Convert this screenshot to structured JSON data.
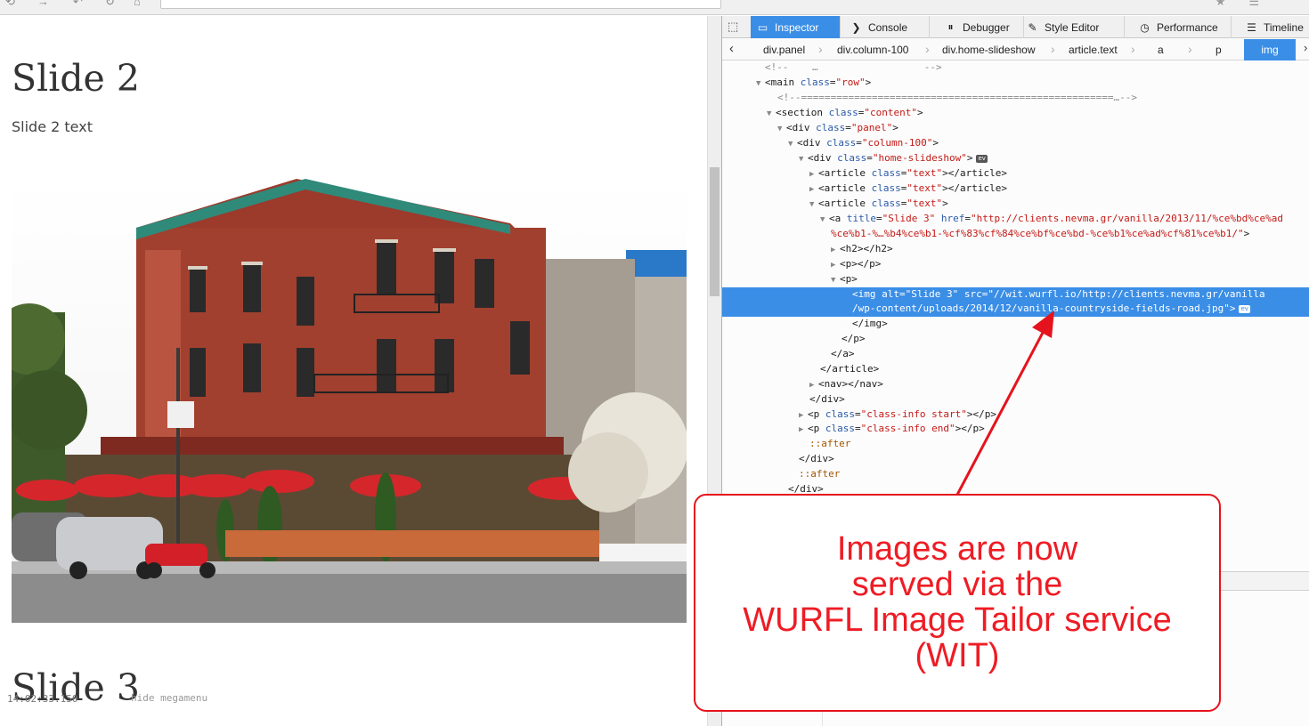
{
  "page": {
    "slide2_title": "Slide 2",
    "slide2_text": "Slide 2 text",
    "slide3_title": "Slide 3"
  },
  "devtools": {
    "tabs": [
      {
        "label": "Inspector",
        "icon": "inspector-icon"
      },
      {
        "label": "Console",
        "icon": "console-icon"
      },
      {
        "label": "Debugger",
        "icon": "debugger-icon"
      },
      {
        "label": "Style Editor",
        "icon": "style-editor-icon"
      },
      {
        "label": "Performance",
        "icon": "performance-icon"
      },
      {
        "label": "Timeline",
        "icon": "timeline-icon"
      }
    ],
    "breadcrumbs": [
      "div.panel",
      "div.column-100",
      "div.home-slideshow",
      "article.text",
      "a",
      "p",
      "img"
    ],
    "markup": {
      "comment_top": "<!--    …                  -->",
      "comment_bar": "<!--=====================================================…-->",
      "href_value": "\"http://clients.nevma.gr/vanilla/2013/11/%ce%bd%ce%ad",
      "href_cont": "%ce%b1-%…%b4%ce%b1-%cf%83%cf%84%ce%bf%ce%bd-%ce%b1%ce%ad%cf%81%ce%b1/\"",
      "img_src_line1": "<img alt=\"Slide 3\" src=\"//wit.wurfl.io/http://clients.nevma.gr/vanilla",
      "img_src_line2": "/wp-content/uploads/2014/12/vanilla-countryside-fields-road.jpg\">",
      "badge": "ev"
    },
    "console": {
      "time": "14:02:33.150",
      "message": "hide megamenu"
    }
  },
  "annotation": {
    "text": "Images are now\nserved via the\nWURFL Image Tailor service\n(WIT)",
    "color": "#ee1c24"
  }
}
